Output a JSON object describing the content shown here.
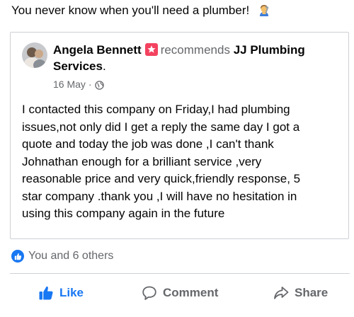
{
  "post": {
    "text": "You never know when you'll need a plumber!",
    "emoji_icon": "plumber-emoji"
  },
  "recommendation": {
    "author": "Angela Bennett",
    "verb": "recommends",
    "page_name": "JJ Plumbing Services",
    "page_name_suffix": ".",
    "date": "16 May",
    "separator": "·",
    "audience_icon": "globe-icon",
    "body_lines": [
      "I contacted this company on Friday,I had plumbing",
      "issues,not only did I get a reply the same day I got a",
      "quote and today the job was done ,I can't thank",
      "Johnathan enough for a brilliant service ,very",
      "reasonable price and very quick,friendly response,  5",
      "star company .thank you ,I will have no hesitation in",
      "using this company again in the future"
    ]
  },
  "reactions": {
    "summary": "You and 6 others"
  },
  "actions": {
    "like": "Like",
    "comment": "Comment",
    "share": "Share"
  },
  "colors": {
    "accent": "#1877f2",
    "recommend_badge": "#f3425f",
    "secondary_text": "#65676b",
    "border": "#ced0d4"
  }
}
